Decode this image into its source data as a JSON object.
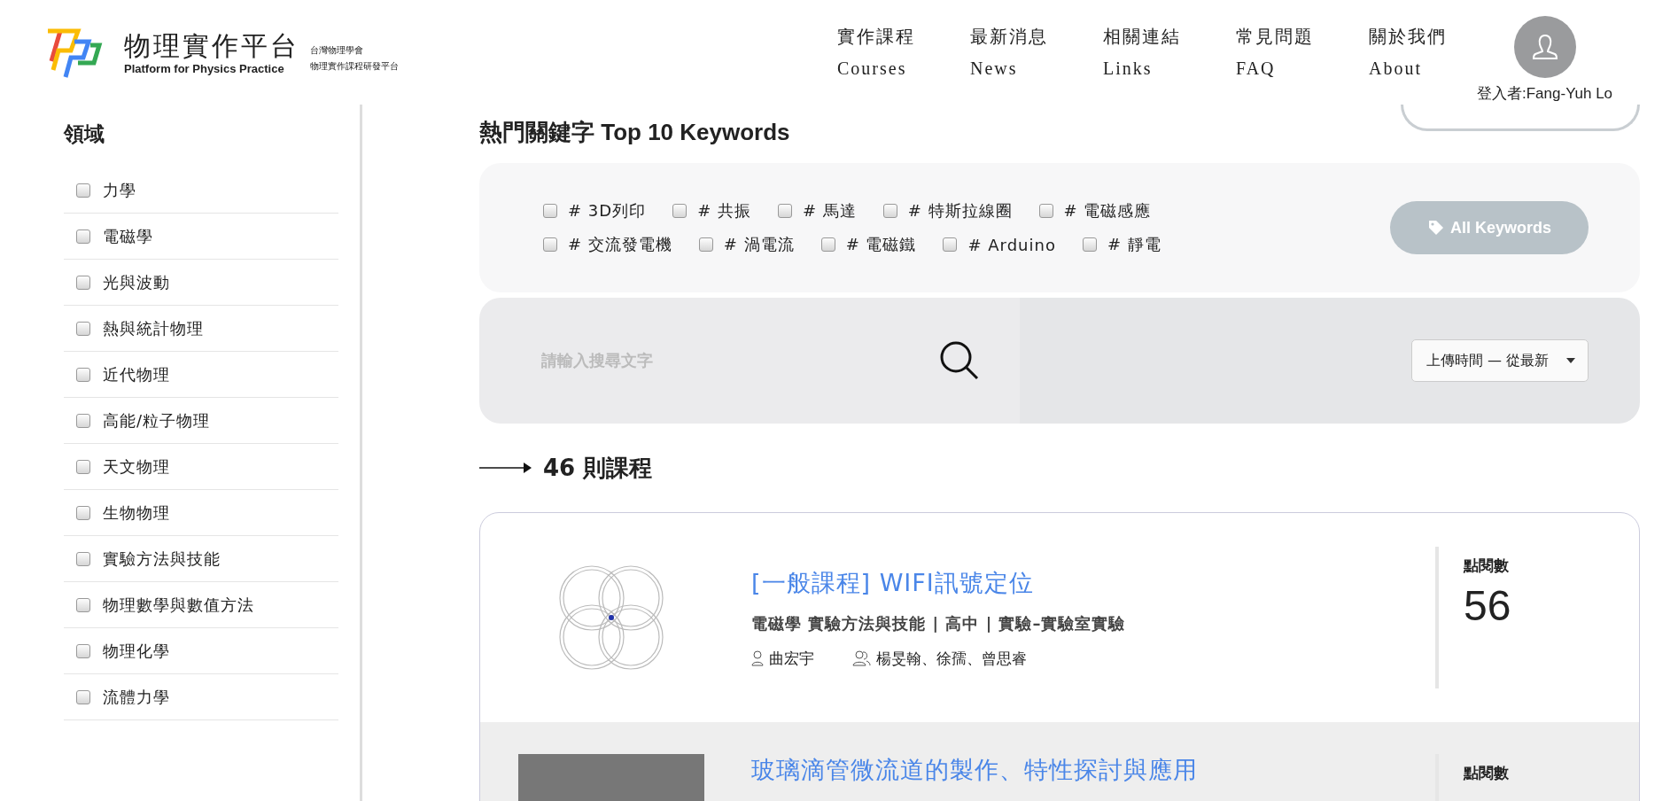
{
  "header": {
    "logo": {
      "title": "物理實作平台",
      "subtitle": "Platform for Physics Practice",
      "org_line_1": "台灣物理學會",
      "org_line_2": "物理實作課程研發平台"
    },
    "nav": [
      {
        "zh": "實作課程",
        "en": "Courses"
      },
      {
        "zh": "最新消息",
        "en": "News"
      },
      {
        "zh": "相關連結",
        "en": "Links"
      },
      {
        "zh": "常見問題",
        "en": "FAQ"
      },
      {
        "zh": "關於我們",
        "en": "About"
      }
    ],
    "user": {
      "login_label": "登入者:Fang-Yuh Lo"
    }
  },
  "sidebar": {
    "title": "領域",
    "items": [
      {
        "label": "力學",
        "checked": false
      },
      {
        "label": "電磁學",
        "checked": false
      },
      {
        "label": "光與波動",
        "checked": false
      },
      {
        "label": "熱與統計物理",
        "checked": false
      },
      {
        "label": "近代物理",
        "checked": false
      },
      {
        "label": "高能/粒子物理",
        "checked": false
      },
      {
        "label": "天文物理",
        "checked": false
      },
      {
        "label": "生物物理",
        "checked": false
      },
      {
        "label": "實驗方法與技能",
        "checked": false
      },
      {
        "label": "物理數學與數值方法",
        "checked": false
      },
      {
        "label": "物理化學",
        "checked": false
      },
      {
        "label": "流體力學",
        "checked": false
      }
    ]
  },
  "keywords": {
    "title": "熱門關鍵字 Top 10 Keywords",
    "rows": [
      [
        {
          "label": "# 3D列印",
          "checked": false
        },
        {
          "label": "# 共振",
          "checked": false
        },
        {
          "label": "# 馬達",
          "checked": false
        },
        {
          "label": "# 特斯拉線圈",
          "checked": false
        },
        {
          "label": "# 電磁感應",
          "checked": false
        }
      ],
      [
        {
          "label": "# 交流發電機",
          "checked": false
        },
        {
          "label": "# 渦電流",
          "checked": false
        },
        {
          "label": "# 電磁鐵",
          "checked": false
        },
        {
          "label": "# Arduino",
          "checked": false
        },
        {
          "label": "# 靜電",
          "checked": false
        }
      ]
    ],
    "button": "All Keywords"
  },
  "search": {
    "placeholder": "請輸入搜尋文字",
    "sort": "上傳時間 — 從最新"
  },
  "results": {
    "count": "46 則課程"
  },
  "courses": [
    {
      "kind": "diagram",
      "highlighted": false,
      "title": "[一般課程] WIFI訊號定位",
      "tags": "電磁學 實驗方法與技能 | 高中 | 實驗–實驗室實驗",
      "author": "曲宏宇",
      "members": "楊旻翰、徐孺、曾思睿",
      "views_label": "點閱數",
      "views": "56"
    },
    {
      "kind": "photo",
      "highlighted": true,
      "title": "玻璃滴管微流道的製作、特性探討與應用",
      "views_label": "點閱數"
    }
  ]
}
